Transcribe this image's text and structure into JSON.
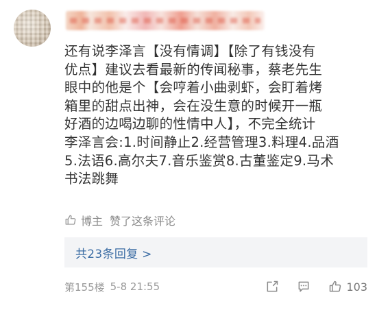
{
  "comment": {
    "body": "还有说李泽言【没有情调】【除了有钱没有\n优点】建议去看最新的传闻秘事，蔡老先生\n眼中的他是个【会哼着小曲剥虾，会盯着烤\n箱里的甜点出神，会在没生意的时候开一瓶\n好酒的边喝边聊的性情中人】，不完全统计\n李泽言会:1.时间静止2.经营管理3.料理4.品酒\n5.法语6.高尔夫7.音乐鉴赏8.古董鉴定9.马术\n书法跳舞",
    "author_like": {
      "icon": "thumbs-up-outline-icon",
      "author_label": "博主",
      "liked_text": "赞了这条评论"
    },
    "replies_link": "共23条回复 >",
    "footer": {
      "floor": "第155楼",
      "time": "5-8 21:55",
      "actions": {
        "edit_icon": "edit-icon",
        "comment_icon": "comment-icon",
        "like_icon": "thumbs-up-outline-icon",
        "like_count": "103"
      }
    }
  },
  "colors": {
    "body_text": "#333333",
    "meta_text": "#8a8a8a",
    "link_blue": "#3d6ea5",
    "replies_bg": "#f3f4f6"
  }
}
